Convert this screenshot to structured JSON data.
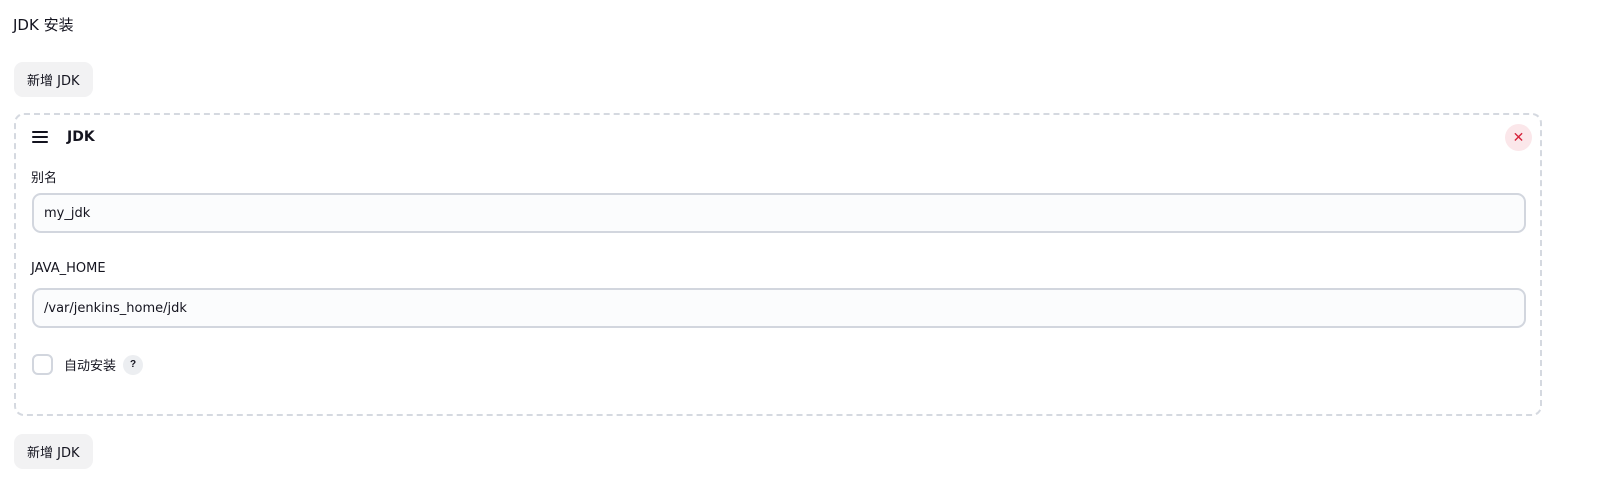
{
  "section": {
    "title": "JDK 安装"
  },
  "buttons": {
    "add_jdk_top": "新增 JDK",
    "add_jdk_bottom": "新增 JDK"
  },
  "jdk_card": {
    "title": "JDK",
    "delete_icon": "close-icon",
    "drag_icon": "drag-handle-icon",
    "fields": {
      "alias_label": "别名",
      "alias_value": "my_jdk",
      "java_home_label": "JAVA_HOME",
      "java_home_value": "/var/jenkins_home/jdk"
    },
    "auto_install": {
      "label": "自动安装",
      "checked": false,
      "help_symbol": "?"
    }
  },
  "colors": {
    "delete_accent": "#d6233b",
    "delete_bg": "#fbe7ea",
    "button_bg": "#f2f2f3",
    "input_border": "#d2d6de",
    "card_border": "#d5d9e0"
  }
}
